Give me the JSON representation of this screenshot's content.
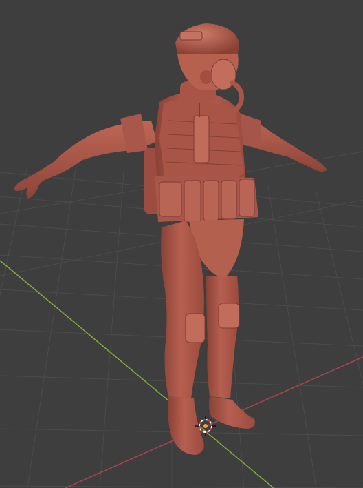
{
  "viewport": {
    "background_color": "#3e3e3e",
    "grid_color": "#4d4d4d",
    "x_axis_color": "#a6434b",
    "y_axis_color": "#7eaa3a",
    "model_color": "#b05a4c",
    "model_shadow_color": "#7d3a31",
    "model_highlight_color": "#cf7a68"
  },
  "scene": {
    "object": "soldier-model",
    "origin_marker": "3d-cursor-icon"
  }
}
